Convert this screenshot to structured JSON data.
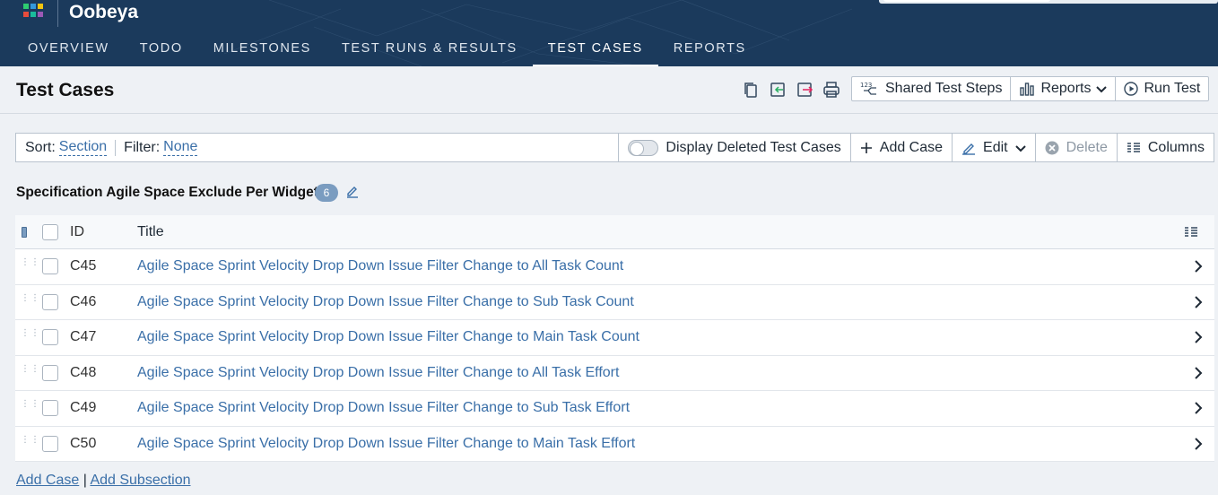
{
  "app": {
    "title": "Oobeya",
    "logo_icon": "grid-logo-icon"
  },
  "nav": {
    "tabs": [
      {
        "label": "OVERVIEW",
        "active": false
      },
      {
        "label": "TODO",
        "active": false
      },
      {
        "label": "MILESTONES",
        "active": false
      },
      {
        "label": "TEST RUNS & RESULTS",
        "active": false
      },
      {
        "label": "TEST CASES",
        "active": true
      },
      {
        "label": "REPORTS",
        "active": false
      }
    ]
  },
  "page": {
    "title": "Test Cases",
    "icons": [
      "copy-icon",
      "import-icon",
      "export-icon",
      "print-icon"
    ],
    "actions": {
      "shared_steps": "Shared Test Steps",
      "reports": "Reports",
      "run_test": "Run Test"
    }
  },
  "toolbar": {
    "sort_label": "Sort:",
    "sort_value": "Section",
    "filter_label": "Filter:",
    "filter_value": "None",
    "display_deleted": "Display Deleted Test Cases",
    "display_deleted_on": false,
    "add_case": "Add Case",
    "edit": "Edit",
    "delete": "Delete",
    "columns": "Columns"
  },
  "section": {
    "title": "Specification Agile Space Exclude Per Widget",
    "count": "6"
  },
  "table": {
    "headers": {
      "id": "ID",
      "title": "Title"
    },
    "rows": [
      {
        "id": "C45",
        "title": "Agile Space Sprint Velocity Drop Down Issue Filter Change to All Task Count"
      },
      {
        "id": "C46",
        "title": "Agile Space Sprint Velocity Drop Down Issue Filter Change to Sub Task Count"
      },
      {
        "id": "C47",
        "title": "Agile Space Sprint Velocity Drop Down Issue Filter Change to Main Task Count"
      },
      {
        "id": "C48",
        "title": "Agile Space Sprint Velocity Drop Down Issue Filter Change to All Task Effort"
      },
      {
        "id": "C49",
        "title": "Agile Space Sprint Velocity Drop Down Issue Filter Change to Sub Task Effort"
      },
      {
        "id": "C50",
        "title": "Agile Space Sprint Velocity Drop Down Issue Filter Change to Main Task Effort"
      }
    ]
  },
  "footer": {
    "add_case": "Add Case",
    "separator": "|",
    "add_subsection": "Add Subsection"
  },
  "colors": {
    "header_bg": "#1b3a5c",
    "link": "#3a6fa8",
    "badge": "#7a9cc0",
    "page_bg": "#eef1f5"
  }
}
